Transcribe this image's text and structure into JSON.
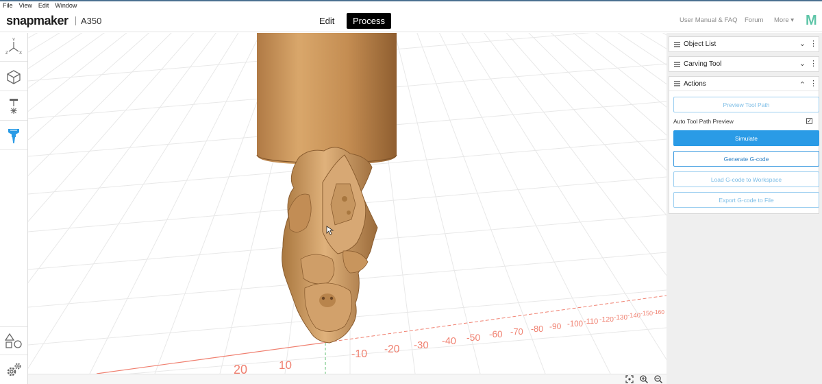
{
  "menubar": {
    "items": [
      "File",
      "View",
      "Edit",
      "Window"
    ]
  },
  "header": {
    "logo": "snapmaker",
    "model": "A350",
    "modes": [
      {
        "label": "Edit",
        "active": false
      },
      {
        "label": "Process",
        "active": true
      }
    ],
    "links": {
      "manual": "User Manual & FAQ",
      "forum": "Forum",
      "more": "More ▾"
    },
    "brand_letter": "M",
    "brand_color": "#5ec5a8"
  },
  "toolbar": {
    "items": [
      {
        "icon": "axes-icon",
        "axis_labels": [
          "Y",
          "Z",
          "X"
        ]
      },
      {
        "icon": "cube-icon"
      },
      {
        "icon": "laser-icon"
      },
      {
        "icon": "cnc-icon",
        "active": true,
        "active_color": "#2a9be6"
      }
    ],
    "bottom_items": [
      {
        "icon": "shapes-icon"
      },
      {
        "icon": "gear-icon"
      }
    ]
  },
  "viewport": {
    "axis_color": "#f08070",
    "axis_ticks": [
      "20",
      "10",
      "-10",
      "-20",
      "-30",
      "-40",
      "-50",
      "-60",
      "-70",
      "-80",
      "-90",
      "-100",
      "-110",
      "-120",
      "-130",
      "-140",
      "-150",
      "-160"
    ],
    "model_color": "#c9965e",
    "bottom_icons": [
      "fit-view-icon",
      "zoom-in-icon",
      "zoom-out-icon"
    ]
  },
  "panel": {
    "sections": [
      {
        "title": "Object List",
        "expanded": false
      },
      {
        "title": "Carving Tool",
        "expanded": false
      },
      {
        "title": "Actions",
        "expanded": true
      }
    ],
    "actions": {
      "preview": "Preview Tool Path",
      "auto_preview": "Auto Tool Path Preview",
      "auto_preview_checked": true,
      "simulate": "Simulate",
      "generate": "Generate G-code",
      "load": "Load G-code to Workspace",
      "export": "Export G-code to File"
    },
    "accent": "#2a9be6"
  }
}
